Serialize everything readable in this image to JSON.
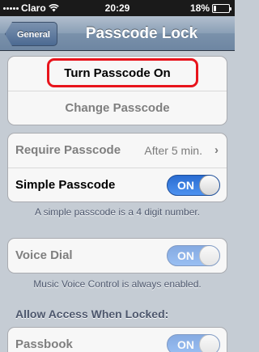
{
  "status_bar": {
    "carrier": "Claro",
    "time": "20:29",
    "battery": "18%",
    "battery_level": 0.18
  },
  "nav": {
    "back_label": "General",
    "title": "Passcode Lock"
  },
  "passcode_group": {
    "turn_on_label": "Turn Passcode On",
    "change_label": "Change Passcode"
  },
  "settings_group": {
    "require_label": "Require Passcode",
    "require_value": "After 5 min.",
    "simple_label": "Simple Passcode",
    "simple_toggle": "ON"
  },
  "simple_footer": "A simple passcode is a 4 digit number.",
  "voice_group": {
    "voice_label": "Voice Dial",
    "voice_toggle": "ON"
  },
  "voice_footer": "Music Voice Control is always enabled.",
  "access_header": "Allow Access When Locked:",
  "access_group": {
    "passbook_label": "Passbook",
    "passbook_toggle": "ON"
  },
  "colors": {
    "toggle_on": "#2a6cd1",
    "highlight": "#e8141c",
    "nav_bar": "#7a91ab"
  }
}
